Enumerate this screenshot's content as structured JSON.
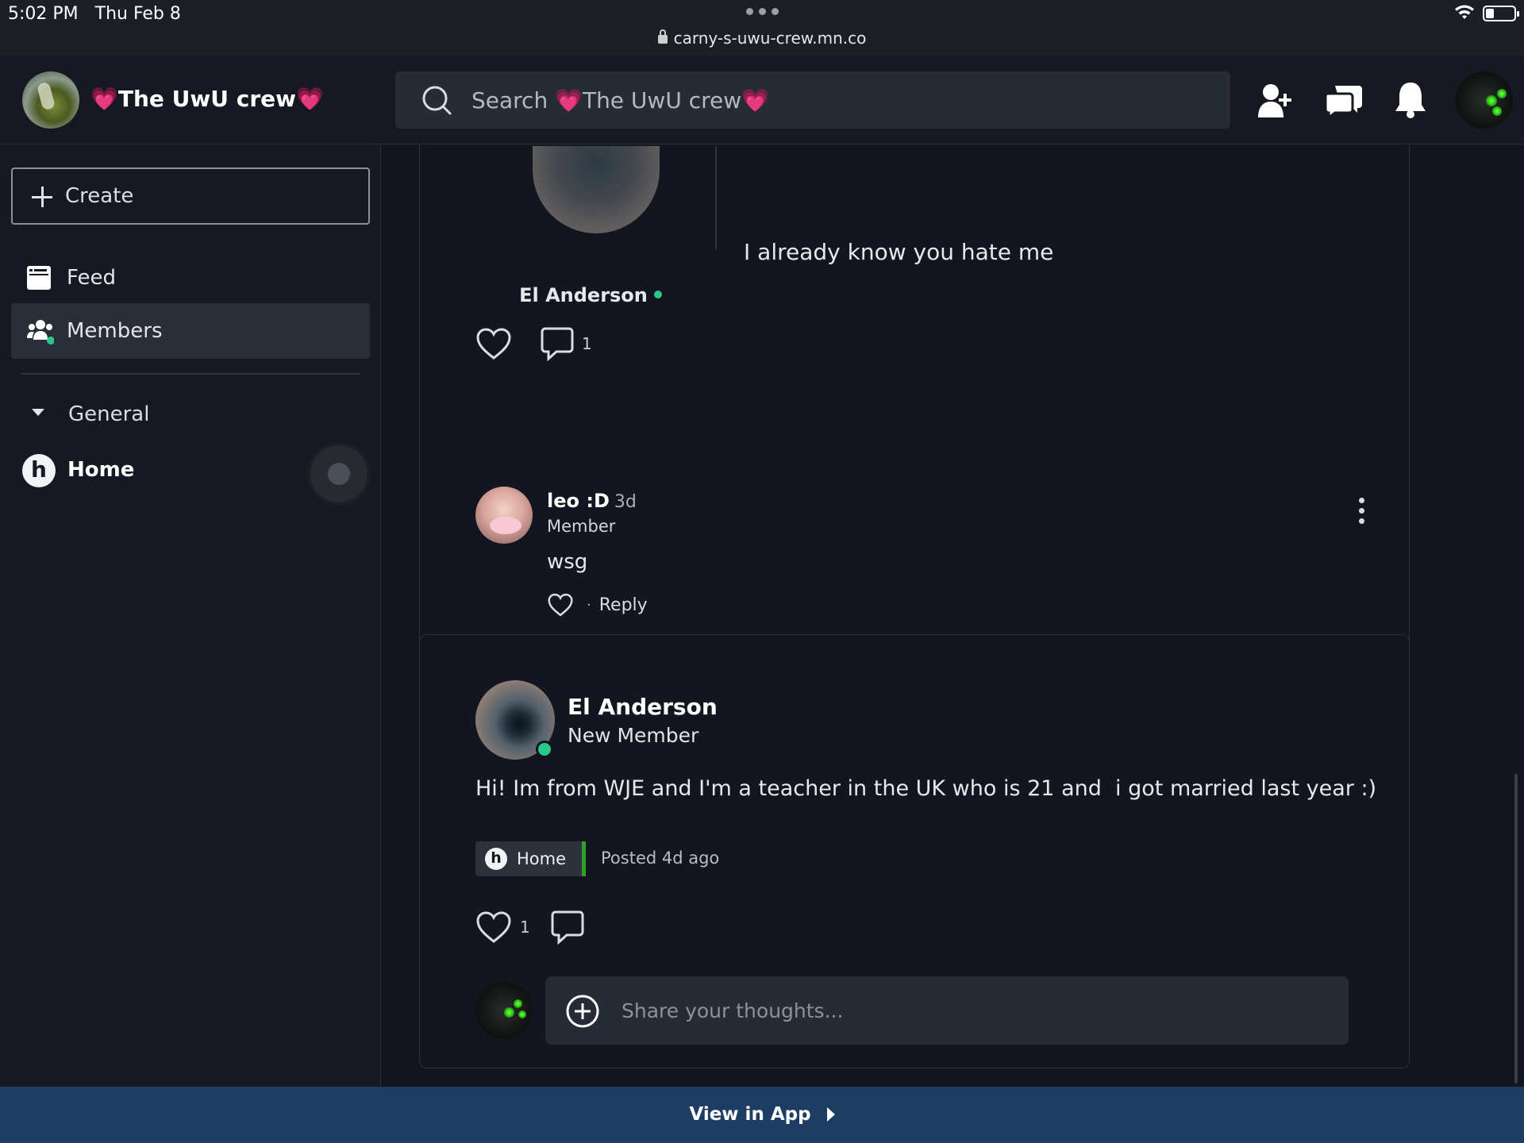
{
  "statusbar": {
    "time": "5:02 PM   Thu Feb 8",
    "url": "carny-s-uwu-crew.mn.co",
    "battery_level": 0.3
  },
  "header": {
    "community_name": "💗The UwU crew💗",
    "search_placeholder": "Search 💗The UwU crew💗",
    "icons": [
      "add-member-icon",
      "chat-icon",
      "bell-icon"
    ]
  },
  "sidebar": {
    "create_label": "Create",
    "nav": [
      {
        "label": "Feed",
        "icon": "feed-icon"
      },
      {
        "label": "Members",
        "icon": "members-icon",
        "active": true
      }
    ],
    "group_label": "General",
    "home_badge": "h",
    "home_label": "Home"
  },
  "post1": {
    "author": "El Anderson",
    "text": "I already know you hate me",
    "comment_count": "1"
  },
  "comment1": {
    "author": "leo :D",
    "time": "3d",
    "role": "Member",
    "text": "wsg",
    "reply_label": "Reply",
    "separator": "·"
  },
  "composer": {
    "placeholder": "Share your thoughts..."
  },
  "post2": {
    "author": "El Anderson",
    "role": "New Member",
    "text": "Hi! Im from WJE and I'm a teacher in the UK who is 21 and  i got married last year :)",
    "tag_badge": "h",
    "tag_label": "Home",
    "posted": "Posted 4d ago",
    "like_count": "1"
  },
  "footer": {
    "view_in_app": "View in App"
  },
  "colors": {
    "background": "#13161f",
    "online": "#28c98a",
    "footer": "#1e3d63",
    "tag_accent": "#2fa12a"
  }
}
